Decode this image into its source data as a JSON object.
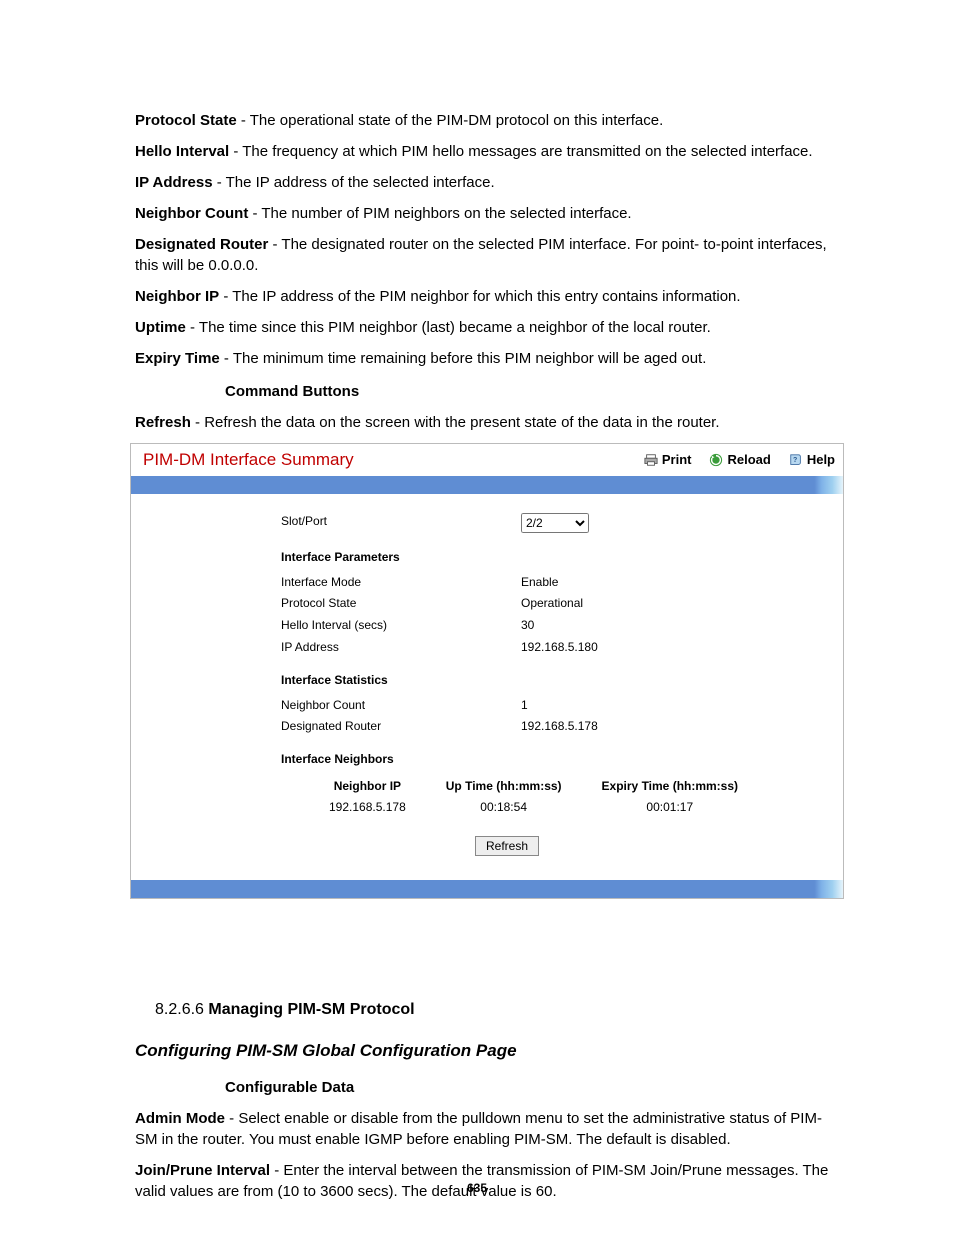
{
  "defs": [
    {
      "term": "Protocol State",
      "desc": " - The operational state of the PIM-DM protocol on this interface."
    },
    {
      "term": "Hello Interval",
      "desc": " - The frequency at which PIM hello messages are transmitted on the selected interface."
    },
    {
      "term": "IP Address",
      "desc": " - The IP address of the selected interface."
    },
    {
      "term": "Neighbor Count",
      "desc": " - The number of PIM neighbors on the selected interface."
    },
    {
      "term": "Designated Router",
      "desc": " - The designated router on the selected PIM interface. For point- to-point interfaces, this will be 0.0.0.0."
    },
    {
      "term": "Neighbor IP",
      "desc": " - The IP address of the PIM neighbor for which this entry contains information."
    },
    {
      "term": "Uptime",
      "desc": " - The time since this PIM neighbor (last) became a neighbor of the local router."
    },
    {
      "term": "Expiry Time",
      "desc": " - The minimum time remaining before this PIM neighbor will be aged out."
    }
  ],
  "cmd_head": "Command Buttons",
  "refresh_def": {
    "term": "Refresh",
    "desc": " - Refresh the data on the screen with the present state of the data in the router."
  },
  "panel": {
    "title": "PIM-DM Interface Summary",
    "print": "Print",
    "reload": "Reload",
    "help": "Help",
    "slot_label": "Slot/Port",
    "slot_value": "2/2",
    "sect_params": "Interface Parameters",
    "rows_params": [
      {
        "label": "Interface Mode",
        "value": "Enable"
      },
      {
        "label": "Protocol State",
        "value": "Operational"
      },
      {
        "label": "Hello Interval (secs)",
        "value": "30"
      },
      {
        "label": "IP Address",
        "value": "192.168.5.180"
      }
    ],
    "sect_stats": "Interface Statistics",
    "rows_stats": [
      {
        "label": "Neighbor Count",
        "value": "1"
      },
      {
        "label": "Designated Router",
        "value": "192.168.5.178"
      }
    ],
    "sect_neighbors": "Interface Neighbors",
    "ncols": [
      "Neighbor IP",
      "Up Time (hh:mm:ss)",
      "Expiry Time (hh:mm:ss)"
    ],
    "nrow": [
      "192.168.5.178",
      "00:18:54",
      "00:01:17"
    ],
    "refresh_btn": "Refresh"
  },
  "section_num": "8.2.6.6 ",
  "section_title": "Managing PIM-SM Protocol",
  "subsection_title": "Configuring PIM-SM Global Configuration Page",
  "conf_head": "Configurable Data",
  "admin_def": {
    "term": "Admin Mode",
    "desc": " - Select enable or disable from the pulldown menu to set the administrative status of PIM-SM in the router. You must enable IGMP before enabling PIM-SM. The default is disabled."
  },
  "join_def": {
    "term": "Join/Prune Interval",
    "desc": " - Enter the interval between the transmission of PIM-SM Join/Prune messages. The valid values are from (10 to 3600 secs). The default value is 60."
  },
  "page_number": "635"
}
